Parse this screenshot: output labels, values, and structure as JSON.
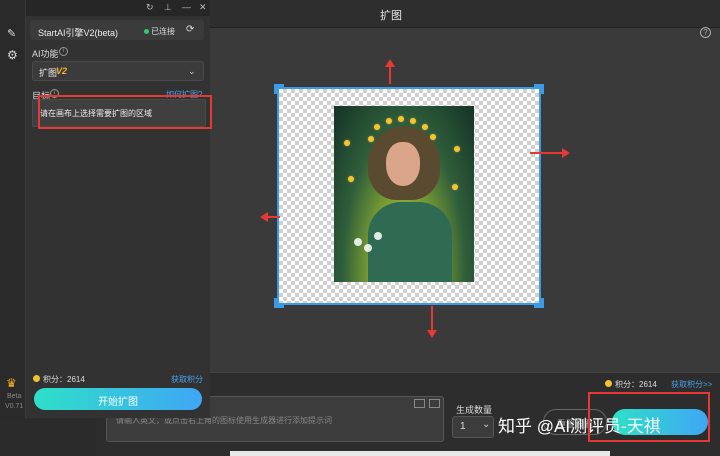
{
  "main": {
    "title": "扩图",
    "help_icon": "?",
    "points_label": "积分：2614",
    "earn_points": "获取积分>>",
    "prompt_placeholder": "请输入英文，或点击右上角的图标使用生成器进行添加提示词",
    "gen_count_label": "生成数量",
    "gen_count_value": "1",
    "reset_label": "重置设置",
    "watermark": "知乎 @AI测评员-天祺"
  },
  "plugin": {
    "engine_name": "StartAI引擎V2(beta)",
    "status": "已连接",
    "ai_function_label": "AI功能",
    "function_select": "扩图",
    "function_version": "V2",
    "target_label": "目标",
    "how_link": "如何扩图?",
    "target_text": "请在画布上选择需要扩图的区域",
    "points_label": "积分：2614",
    "earn_points": "获取积分",
    "start_button": "开始扩图",
    "beta": "Beta",
    "version": "V0.71"
  },
  "colors": {
    "accent_blue": "#3c9be6",
    "highlight_red": "#e53935",
    "button_gradient_start": "#2ee0c8",
    "button_gradient_end": "#3fa6f5",
    "status_green": "#2ecc71"
  },
  "icons": [
    "edit-icon",
    "gear-icon",
    "crown-icon",
    "refresh-icon",
    "pin-icon",
    "minimize-icon",
    "close-icon",
    "info-icon",
    "chevron-down-icon",
    "help-icon"
  ]
}
